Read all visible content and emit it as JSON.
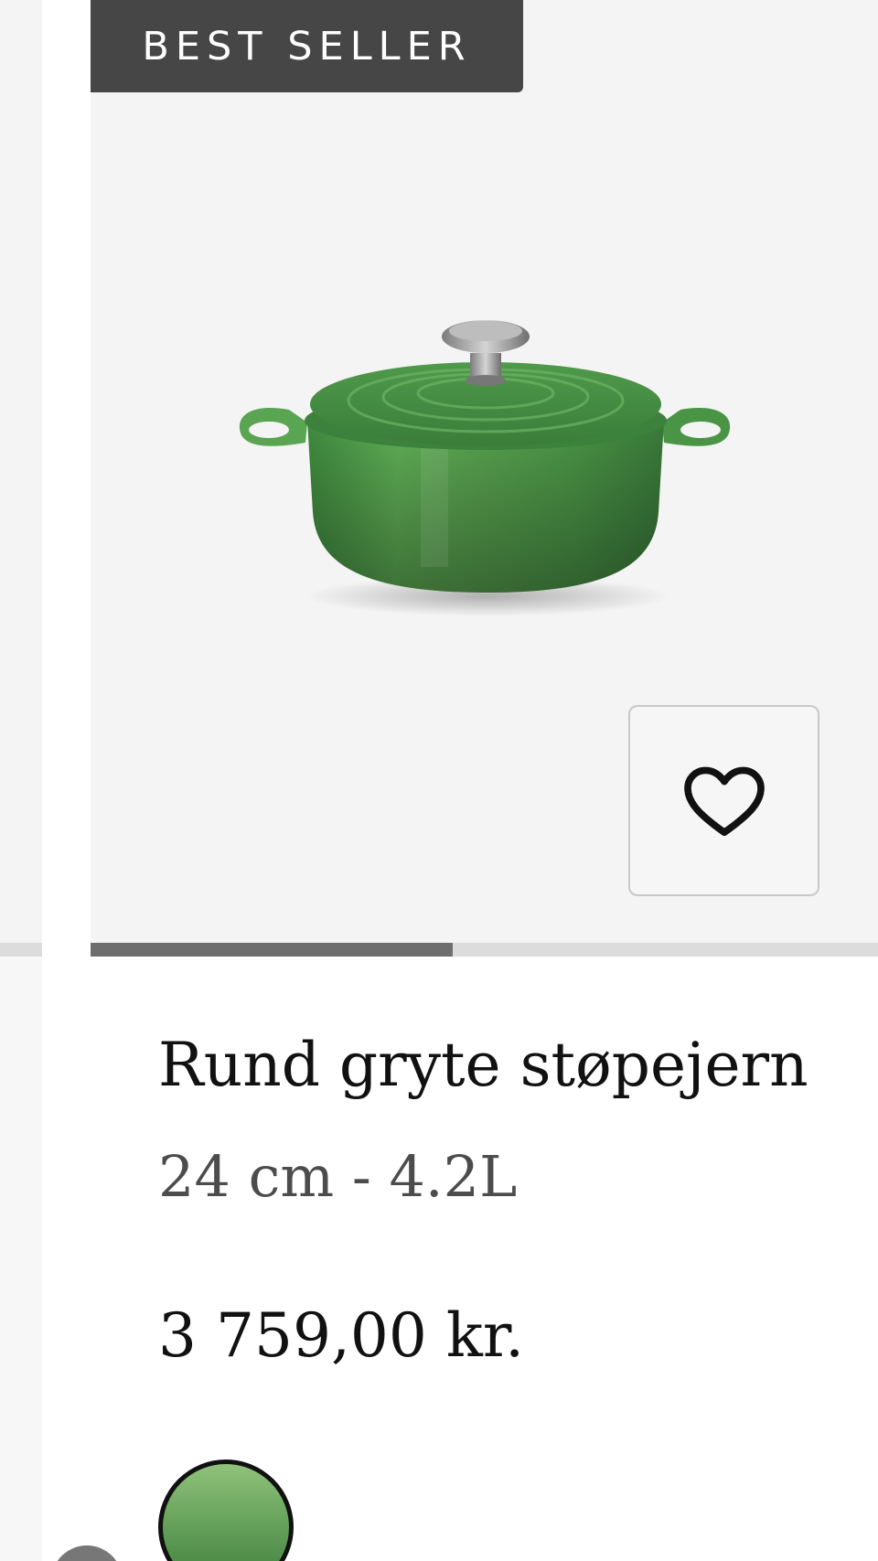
{
  "carousel": {
    "badge": "BEST SELLER",
    "image_alt": "Green round cast iron casserole dish",
    "progress": 0.46,
    "favorite_icon": "heart-icon"
  },
  "product": {
    "name": "Rund gryte støpejern",
    "size": "24 cm - 4.2L",
    "price": "3 759,00 kr."
  },
  "swatches": [
    {
      "color_top": "#90c27a",
      "color_bottom": "#3f7c3d",
      "selected": true
    }
  ],
  "colors": {
    "badge_bg": "#464646",
    "image_bg": "#f4f4f4",
    "track": "#dcdcdc",
    "track_fill": "#6e6e6e"
  }
}
